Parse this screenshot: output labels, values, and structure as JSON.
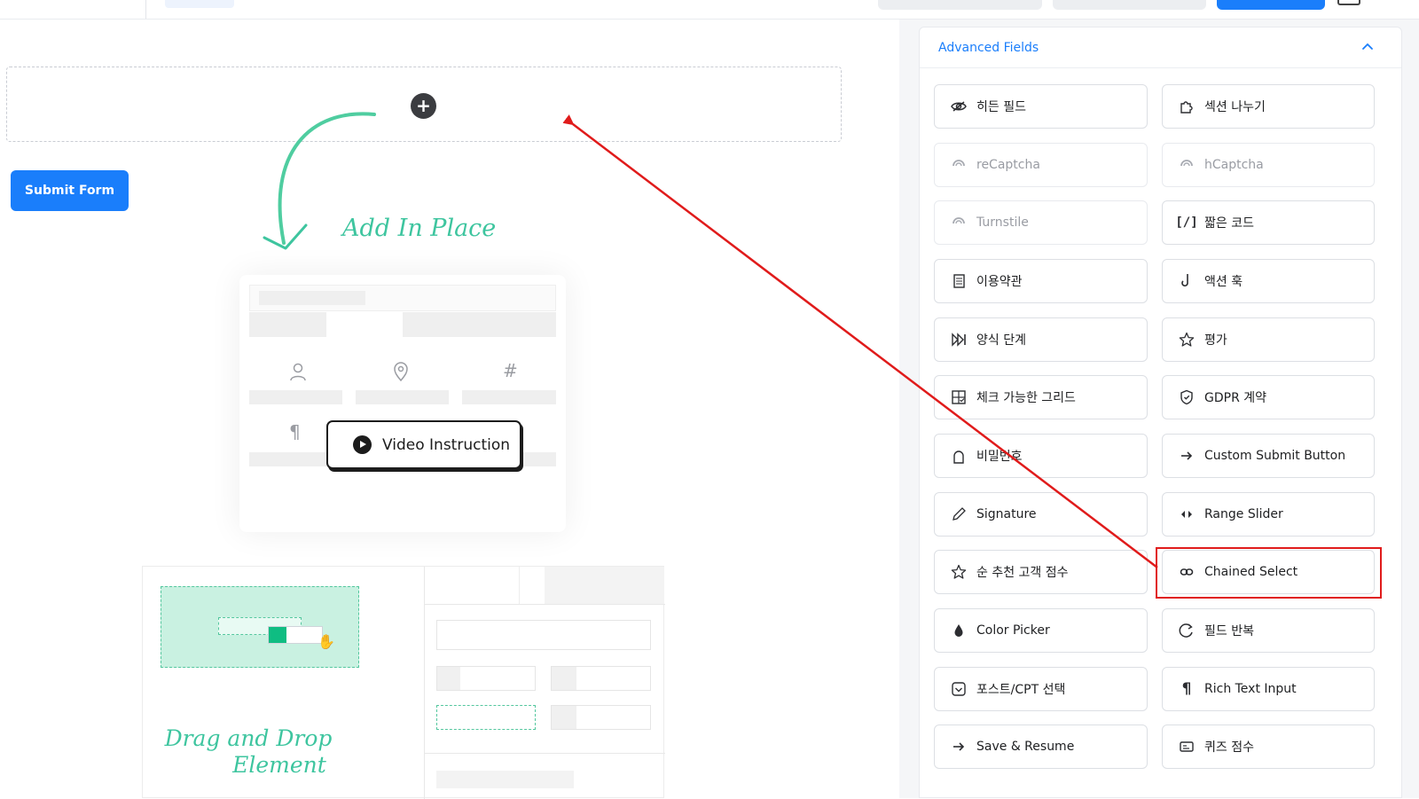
{
  "canvas": {
    "submit_label": "Submit Form",
    "add_in_place": "Add In Place",
    "video_label": "Video Instruction",
    "drag_drop_line1": "Drag and Drop",
    "drag_drop_line2": "Element"
  },
  "panel": {
    "title": "Advanced Fields",
    "fields": [
      {
        "label": "히든 필드",
        "icon": "eye-slash-icon"
      },
      {
        "label": "섹션 나누기",
        "icon": "puzzle-icon"
      },
      {
        "label": "reCaptcha",
        "icon": "captcha-icon",
        "disabled": true
      },
      {
        "label": "hCaptcha",
        "icon": "captcha-icon",
        "disabled": true
      },
      {
        "label": "Turnstile",
        "icon": "captcha-icon",
        "disabled": true
      },
      {
        "label": "짧은 코드",
        "icon": "shortcode-icon"
      },
      {
        "label": "이용약관",
        "icon": "document-icon"
      },
      {
        "label": "액션 훅",
        "icon": "hook-icon"
      },
      {
        "label": "양식 단계",
        "icon": "step-forward-icon"
      },
      {
        "label": "평가",
        "icon": "star-icon"
      },
      {
        "label": "체크 가능한 그리드",
        "icon": "grid-check-icon"
      },
      {
        "label": "GDPR 계약",
        "icon": "shield-icon"
      },
      {
        "label": "비밀번호",
        "icon": "lock-icon"
      },
      {
        "label": "Custom Submit Button",
        "icon": "arrow-right-icon"
      },
      {
        "label": "Signature",
        "icon": "pen-icon"
      },
      {
        "label": "Range Slider",
        "icon": "range-icon"
      },
      {
        "label": "순 추천 고객 점수",
        "icon": "star-icon"
      },
      {
        "label": "Chained Select",
        "icon": "link-icon"
      },
      {
        "label": "Color Picker",
        "icon": "drop-icon"
      },
      {
        "label": "필드 반복",
        "icon": "repeat-icon"
      },
      {
        "label": "포스트/CPT 선택",
        "icon": "post-icon"
      },
      {
        "label": "Rich Text Input",
        "icon": "paragraph-icon"
      },
      {
        "label": "Save & Resume",
        "icon": "arrow-right-icon"
      },
      {
        "label": "퀴즈 점수",
        "icon": "quiz-icon"
      }
    ]
  },
  "colors": {
    "accent": "#1a7efb",
    "highlight": "#e01b1b",
    "script_green": "#3ec59f"
  }
}
